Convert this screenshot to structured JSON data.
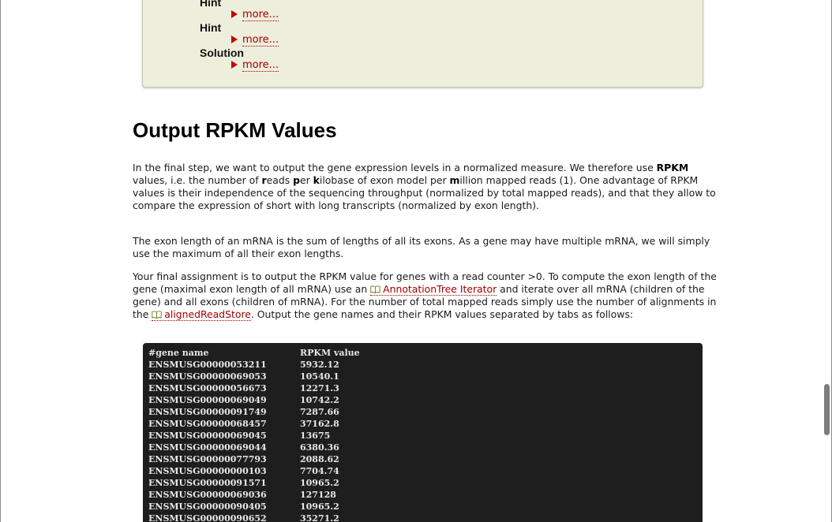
{
  "hints": [
    {
      "title": "Hint",
      "more": "more..."
    },
    {
      "title": "Hint",
      "more": "more..."
    },
    {
      "title": "Solution",
      "more": "more..."
    }
  ],
  "section": {
    "title": "Output RPKM Values"
  },
  "paragraphs": {
    "p1": {
      "a": "In the final step, we want to output the gene expression levels in a normalized measure. We therefore use ",
      "rpkm": "RPKM",
      "b": " values, i.e. the number of ",
      "r": "r",
      "c": "eads ",
      "p": "p",
      "d": "er ",
      "k": "k",
      "e": "ilobase of exon model per ",
      "m": "m",
      "f": "illion mapped reads (1). One advantage of RPKM values is their independence of the sequencing throughput (normalized by total mapped reads), and that they allow to compare the expression of short with long transcripts (normalized by exon length)."
    },
    "p2": "The exon length of an mRNA is the sum of lengths of all its exons. As a gene may have multiple mRNA, we will simply use the maximum of all their exon lengths.",
    "p3": {
      "a": "Your final assignment is to output the RPKM value for genes with a read counter >0. To compute the exon length of the gene (maximal exon length of all mRNA) use an ",
      "link1": "AnnotationTree Iterator",
      "b": " and iterate over all mRNA (children of the gene) and all exons (children of mRNA). For the number of total mapped reads simply use the number of alignments in the ",
      "link2": "alignedReadStore",
      "c": ". Output the gene names and their RPKM values separated by tabs as follows:"
    }
  },
  "code": {
    "header": [
      "#gene name",
      "RPKM value"
    ],
    "rows": [
      [
        "ENSMUSG00000053211",
        "5932.12"
      ],
      [
        "ENSMUSG00000069053",
        "10540.1"
      ],
      [
        "ENSMUSG00000056673",
        "12271.3"
      ],
      [
        "ENSMUSG00000069049",
        "10742.2"
      ],
      [
        "ENSMUSG00000091749",
        "7287.66"
      ],
      [
        "ENSMUSG00000068457",
        "37162.8"
      ],
      [
        "ENSMUSG00000069045",
        "13675"
      ],
      [
        "ENSMUSG00000069044",
        "6380.36"
      ],
      [
        "ENSMUSG00000077793",
        "2088.62"
      ],
      [
        "ENSMUSG00000000103",
        "7704.74"
      ],
      [
        "ENSMUSG00000091571",
        "10965.2"
      ],
      [
        "ENSMUSG00000069036",
        "127128"
      ],
      [
        "ENSMUSG00000090405",
        "10965.2"
      ],
      [
        "ENSMUSG00000090652",
        "35271.2"
      ]
    ]
  },
  "icons": {
    "more_marker": "triangle-right-icon",
    "link_marker": "book-icon"
  },
  "colors": {
    "link": "#a00000",
    "hint_bg": "#eeeedd",
    "code_bg": "#1e1e1e",
    "code_text": "#e8e8e8"
  }
}
